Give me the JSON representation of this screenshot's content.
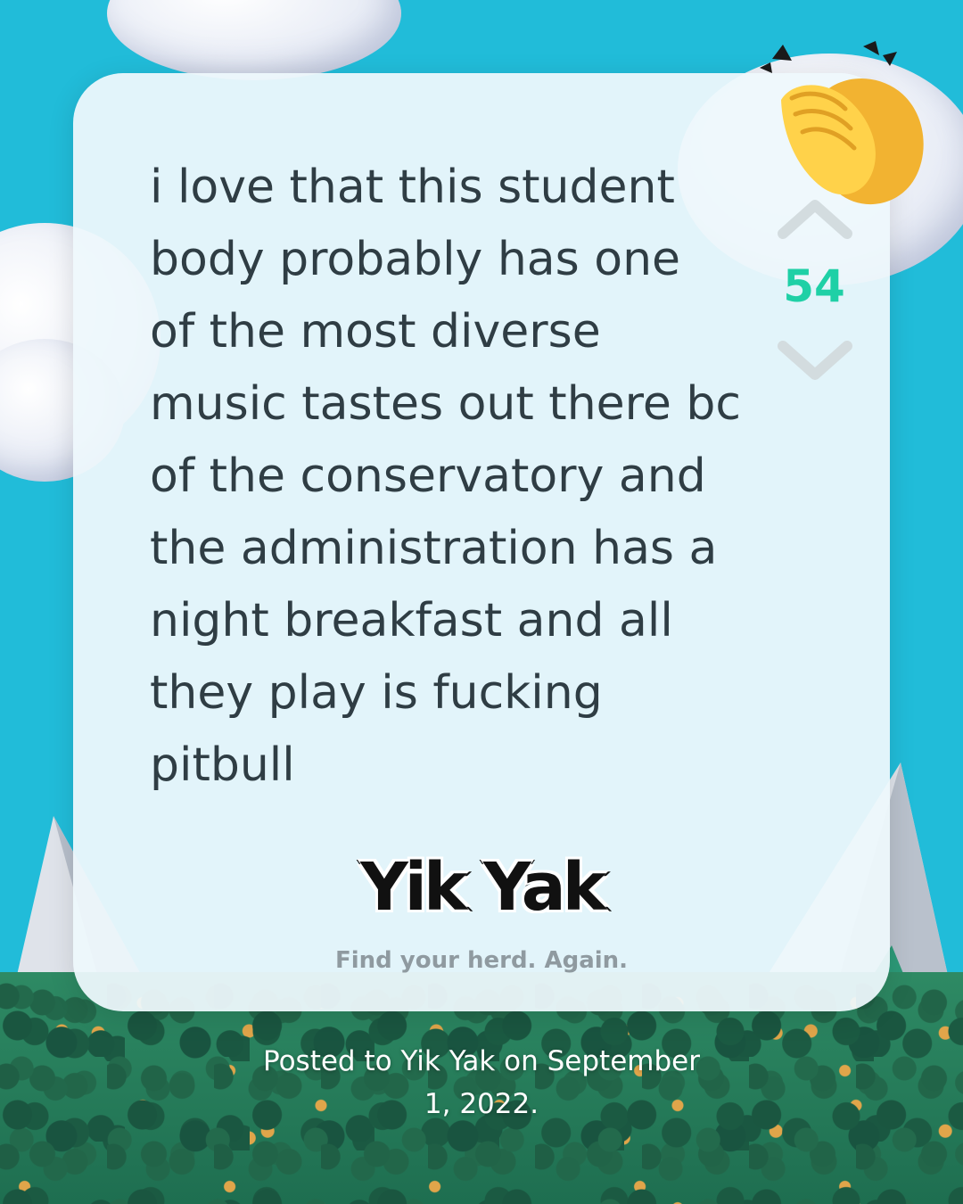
{
  "post": {
    "text": "i love that this student\nbody probably has one\nof the most diverse\nmusic tastes out there bc\nof the conservatory and\nthe administration has a\nnight breakfast and all\nthey play is fucking\npitbull",
    "vote_count": "54"
  },
  "icons": {
    "upvote": "chevron-up-icon",
    "downvote": "chevron-down-icon",
    "reaction": "clapping-hands-icon"
  },
  "branding": {
    "logo_text": "Yik Yak",
    "tagline": "Find your herd. Again."
  },
  "caption": "Posted to Yik Yak on September\n1, 2022.",
  "colors": {
    "background": "#21bcd9",
    "vote_count": "#1fd0a6",
    "post_text": "#2f3d44",
    "chevron": "#d3dcdf"
  }
}
